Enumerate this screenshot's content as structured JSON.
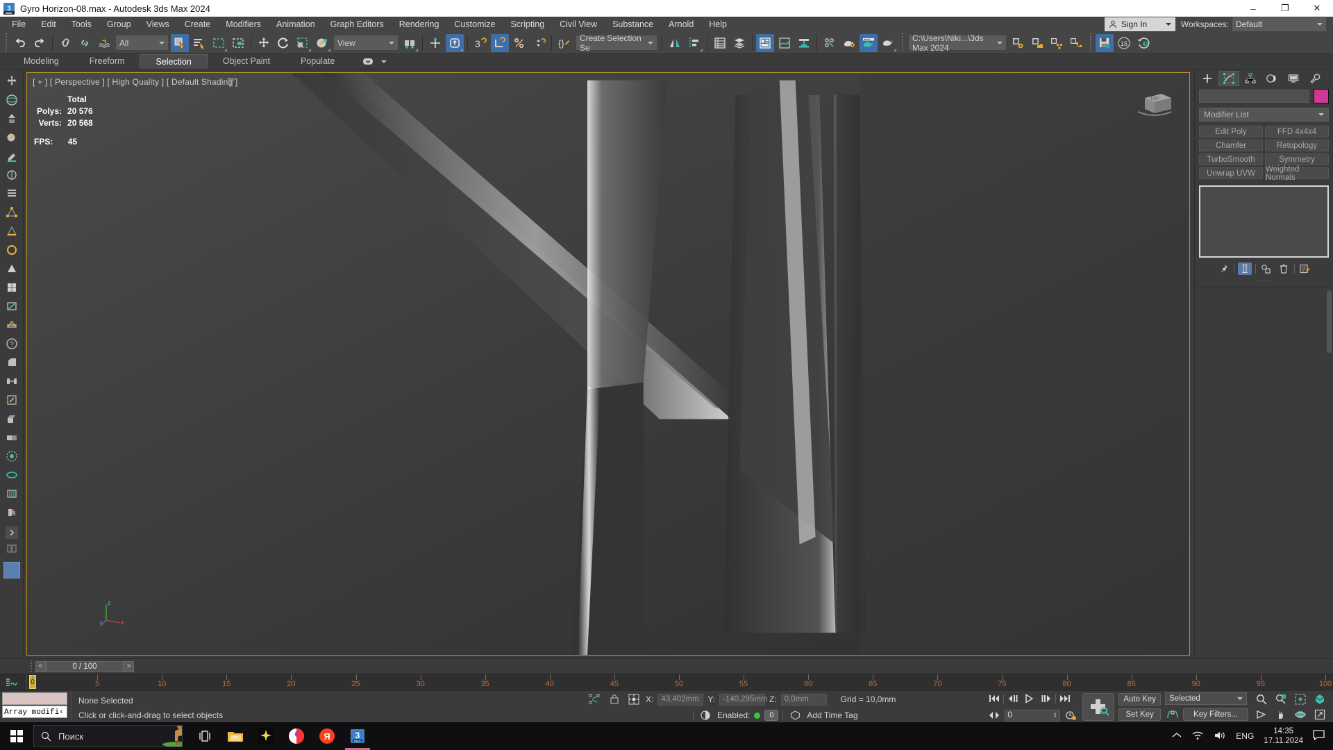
{
  "titlebar": {
    "title": "Gyro Horizon-08.max - Autodesk 3ds Max 2024",
    "app_icon": "3dsmax-icon",
    "minimize": "–",
    "maximize": "❐",
    "close": "✕"
  },
  "menubar": {
    "items": [
      "File",
      "Edit",
      "Tools",
      "Group",
      "Views",
      "Create",
      "Modifiers",
      "Animation",
      "Graph Editors",
      "Rendering",
      "Customize",
      "Scripting",
      "Civil View",
      "Substance",
      "Arnold",
      "Help"
    ],
    "signin_label": "Sign In",
    "workspaces_label": "Workspaces:",
    "workspace_value": "Default"
  },
  "toolbar": {
    "selection_filter": "All",
    "reference_coord": "View",
    "named_selection_sets": "Create Selection Se",
    "project_folder": "C:\\Users\\Niki...\\3ds Max 2024",
    "autobackup_count": "15",
    "items": [
      {
        "name": "undo-icon",
        "label": "Undo"
      },
      {
        "name": "redo-icon",
        "label": "Redo"
      },
      {
        "name": "select-link-icon",
        "label": "Select and Link"
      },
      {
        "name": "unlink-selection-icon",
        "label": "Unlink Selection"
      },
      {
        "name": "bind-space-warp-icon",
        "label": "Bind to Space Warp"
      },
      {
        "name": "select-object-icon",
        "label": "Select Object"
      },
      {
        "name": "select-by-name-icon",
        "label": "Select by Name"
      },
      {
        "name": "rectangular-selection-region-icon",
        "label": "Rectangular Selection Region"
      },
      {
        "name": "window-crossing-icon",
        "label": "Window / Crossing"
      },
      {
        "name": "select-and-move-icon",
        "label": "Select and Move"
      },
      {
        "name": "select-and-rotate-icon",
        "label": "Select and Rotate"
      },
      {
        "name": "select-and-scale-icon",
        "label": "Select and Uniform Scale"
      },
      {
        "name": "select-and-place-icon",
        "label": "Select and Place"
      },
      {
        "name": "use-center-flyout-icon",
        "label": "Use Pivot Point Center"
      },
      {
        "name": "select-and-manipulate-icon",
        "label": "Select and Manipulate"
      },
      {
        "name": "snaps-toggle-icon",
        "label": "Snaps Toggle"
      },
      {
        "name": "angle-snap-icon",
        "label": "Angle Snap Toggle"
      },
      {
        "name": "percent-snap-icon",
        "label": "Percent Snap Toggle"
      },
      {
        "name": "spinner-snap-icon",
        "label": "Spinner Snap Toggle"
      },
      {
        "name": "edit-named-selection-sets-icon",
        "label": "Edit Named Selection Sets"
      },
      {
        "name": "mirror-icon",
        "label": "Mirror"
      },
      {
        "name": "align-icon",
        "label": "Align"
      },
      {
        "name": "layer-explorer-icon",
        "label": "Toggle Scene Explorer"
      },
      {
        "name": "layer-manager-icon",
        "label": "Toggle Layer Explorer"
      },
      {
        "name": "ribbon-icon",
        "label": "Toggle Ribbon"
      },
      {
        "name": "curve-editor-icon",
        "label": "Curve Editor"
      },
      {
        "name": "schematic-view-icon",
        "label": "Schematic View"
      },
      {
        "name": "material-editor-icon",
        "label": "Material Editor"
      },
      {
        "name": "render-setup-icon",
        "label": "Render Setup"
      },
      {
        "name": "rendered-frame-window-icon",
        "label": "Rendered Frame Window"
      },
      {
        "name": "render-production-icon",
        "label": "Render Production"
      },
      {
        "name": "open-explorer-icon",
        "label": "Open Project Folder"
      },
      {
        "name": "save-file-icon",
        "label": "Save File"
      },
      {
        "name": "autobackup-icon",
        "label": "Auto Backup Timer"
      },
      {
        "name": "undo-history-icon",
        "label": "Undo History"
      }
    ]
  },
  "ribbon": {
    "tabs": [
      {
        "label": "Modeling",
        "active": false
      },
      {
        "label": "Freeform",
        "active": false
      },
      {
        "label": "Selection",
        "active": true
      },
      {
        "label": "Object Paint",
        "active": false
      },
      {
        "label": "Populate",
        "active": false
      }
    ]
  },
  "left_toolbar": {
    "items": [
      {
        "name": "move-tool-icon"
      },
      {
        "name": "rotate-tool-icon"
      },
      {
        "name": "scale-tool-icon"
      },
      {
        "name": "place-tool-icon"
      },
      {
        "name": "select-tool-icon"
      },
      {
        "name": "paint-select-icon"
      },
      {
        "name": "list-icon"
      },
      {
        "name": "vertex-icon"
      },
      {
        "name": "edge-icon"
      },
      {
        "name": "border-icon"
      },
      {
        "name": "polygon-icon"
      },
      {
        "name": "element-icon"
      },
      {
        "name": "swift-loop-icon"
      },
      {
        "name": "cut-icon"
      },
      {
        "name": "help-icon"
      },
      {
        "name": "quickslice-icon"
      },
      {
        "name": "chamfer-icon"
      },
      {
        "name": "bridge-icon"
      },
      {
        "name": "weld-icon"
      },
      {
        "name": "attach-icon"
      },
      {
        "name": "detach-icon"
      },
      {
        "name": "grow-icon"
      },
      {
        "name": "shrink-icon"
      },
      {
        "name": "loop-icon"
      },
      {
        "name": "ring-icon"
      },
      {
        "name": "hinge-icon"
      },
      {
        "name": "extrude-icon"
      }
    ],
    "expand_icon": "chevron-right-icon",
    "object-color-swatch": "#5a7fb0"
  },
  "viewport": {
    "label": "[ + ] [ Perspective ] [ High Quality ] [ Default Shading ]",
    "filter_icon": "funnel-icon",
    "stats": {
      "header": "Total",
      "rows": [
        {
          "key": "Polys:",
          "value": "20 576"
        },
        {
          "key": "Verts:",
          "value": "20 568"
        }
      ],
      "fps_key": "FPS:",
      "fps_value": "45"
    },
    "viewcube_label": "TOP",
    "axis_x": "X",
    "axis_y": "Y",
    "axis_z": "Z"
  },
  "command_panel": {
    "tabs": [
      {
        "name": "create-tab",
        "icon": "plus-icon",
        "active": false
      },
      {
        "name": "modify-tab",
        "icon": "modify-icon",
        "active": true
      },
      {
        "name": "hierarchy-tab",
        "icon": "hierarchy-icon",
        "active": false
      },
      {
        "name": "motion-tab",
        "icon": "motion-icon",
        "active": false
      },
      {
        "name": "display-tab",
        "icon": "display-icon",
        "active": false
      },
      {
        "name": "utilities-tab",
        "icon": "wrench-icon",
        "active": false
      }
    ],
    "object_name": "",
    "object_color": "#cf3894",
    "modifier_list_label": "Modifier List",
    "modifier_buttons": [
      "Edit Poly",
      "FFD 4x4x4",
      "Chamfer",
      "Retopology",
      "TurboSmooth",
      "Symmetry",
      "Unwrap UVW",
      "Weighted Normals"
    ],
    "stack_buttons": [
      {
        "name": "pin-stack-icon",
        "active": false
      },
      {
        "name": "show-end-result-icon",
        "active": true
      },
      {
        "name": "make-unique-icon",
        "active": false
      },
      {
        "name": "remove-modifier-icon",
        "active": false
      },
      {
        "name": "configure-modifier-sets-icon",
        "active": false
      }
    ]
  },
  "time_slider": {
    "frame_display": "0 / 100",
    "prev_label": "<",
    "next_label": ">",
    "current_frame": 0,
    "total_frames": 100,
    "tick_labels": [
      "5",
      "10",
      "15",
      "20",
      "25",
      "30",
      "35",
      "40",
      "45",
      "50",
      "55",
      "60",
      "65",
      "70",
      "75",
      "80",
      "85",
      "90",
      "95",
      "100"
    ]
  },
  "status_bar": {
    "listener_text": "Array modifi‹",
    "selection_status": "None Selected",
    "prompt": "Click or click-and-drag to select objects",
    "x_label": "X:",
    "x_value": "43,402mm",
    "y_label": "Y:",
    "y_value": "-140,295mm",
    "z_label": "Z:",
    "z_value": "0,0mm",
    "grid_label": "Grid = 10,0mm",
    "enabled_label": "Enabled:",
    "enabled_value": "0",
    "add_time_tag": "Add Time Tag",
    "auto_key": "Auto Key",
    "set_key": "Set Key",
    "key_mode": "Selected",
    "key_filters": "Key Filters...",
    "frame_field": "0",
    "nav_icons": [
      {
        "name": "zoom-icon"
      },
      {
        "name": "zoom-all-icon"
      },
      {
        "name": "zoom-extents-icon"
      },
      {
        "name": "zoom-extents-selected-icon"
      },
      {
        "name": "field-of-view-icon"
      },
      {
        "name": "pan-view-icon"
      },
      {
        "name": "orbit-icon"
      },
      {
        "name": "maximize-viewport-icon"
      }
    ],
    "playback_icons": [
      {
        "name": "go-to-start-icon"
      },
      {
        "name": "previous-frame-icon"
      },
      {
        "name": "play-animation-icon"
      },
      {
        "name": "next-frame-icon"
      },
      {
        "name": "go-to-end-icon"
      }
    ]
  },
  "taskbar": {
    "start_icon": "windows-start-icon",
    "search_placeholder": "Поиск",
    "search_icon": "search-icon",
    "apps": [
      {
        "name": "task-view-icon",
        "active": false
      },
      {
        "name": "file-explorer-icon",
        "active": false
      },
      {
        "name": "sparkle-app-icon",
        "active": false
      },
      {
        "name": "yandex-browser-icon",
        "active": false
      },
      {
        "name": "yandex-app-icon",
        "active": false
      },
      {
        "name": "3dsmax-taskbar-icon",
        "active": true
      }
    ],
    "tray": {
      "chevron": "show-hidden-icons",
      "network": "wifi-icon",
      "volume": "speaker-icon",
      "language": "ENG",
      "time": "14:35",
      "date": "17.11.2024",
      "notifications": "notification-icon"
    }
  }
}
